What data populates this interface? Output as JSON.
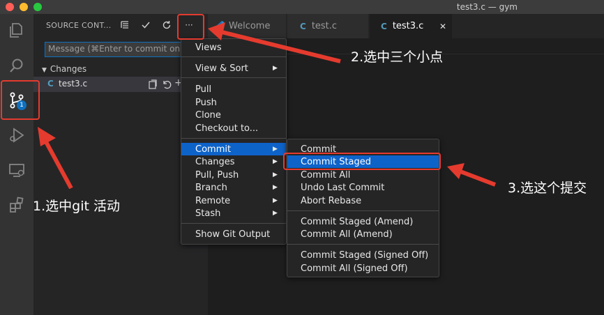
{
  "window": {
    "title": "test3.c — gym"
  },
  "activity_bar": {
    "scm_badge": "1"
  },
  "sidebar": {
    "title": "SOURCE CONT...",
    "actions": {
      "more": "···"
    },
    "message_placeholder": "Message (⌘Enter to commit on",
    "changes_label": "Changes",
    "file": {
      "icon_letter": "C",
      "name": "test3.c"
    }
  },
  "tabs": [
    {
      "icon": "",
      "label": "Welcome"
    },
    {
      "icon": "C",
      "label": "test.c"
    },
    {
      "icon": "C",
      "label": "test3.c",
      "close": "✕"
    }
  ],
  "menu": {
    "items": [
      "Views",
      "View & Sort",
      "Pull",
      "Push",
      "Clone",
      "Checkout to...",
      "Commit",
      "Changes",
      "Pull, Push",
      "Branch",
      "Remote",
      "Stash",
      "Show Git Output"
    ]
  },
  "submenu": {
    "items": [
      "Commit",
      "Commit Staged",
      "Commit All",
      "Undo Last Commit",
      "Abort Rebase",
      "Commit Staged (Amend)",
      "Commit All (Amend)",
      "Commit Staged (Signed Off)",
      "Commit All (Signed Off)"
    ]
  },
  "annotations": {
    "step1": "1.选中git 活动",
    "step2": "2.选中三个小点",
    "step3": "3.选这个提交"
  },
  "colors": {
    "highlight": "#0e63c9",
    "annotation_red": "#e53b2e",
    "accent_blue": "#0e70c0"
  }
}
